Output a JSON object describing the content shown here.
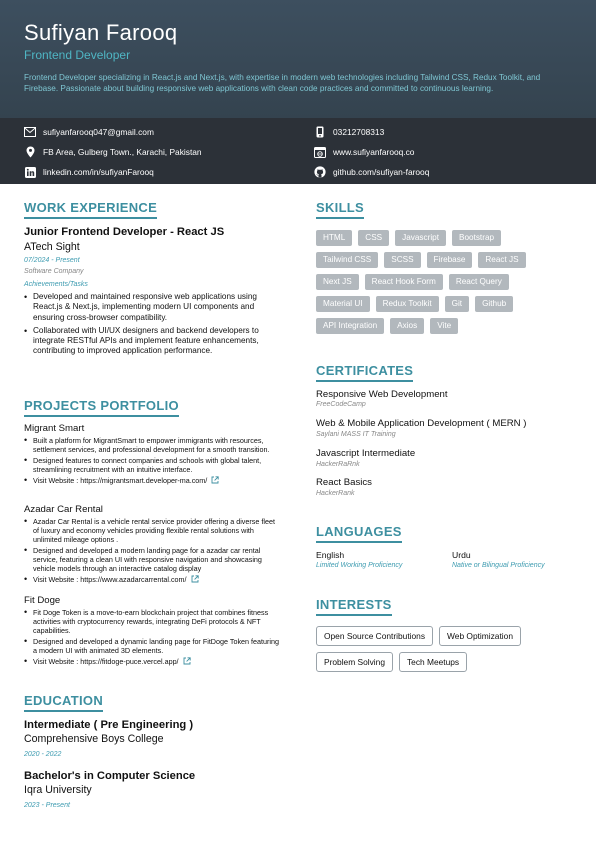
{
  "header": {
    "name": "Sufiyan Farooq",
    "role": "Frontend Developer",
    "summary": "Frontend Developer specializing in React.js and Next.js, with expertise in modern web technologies including Tailwind CSS, Redux Toolkit, and Firebase. Passionate about building responsive web applications with clean code practices and committed to continuous learning."
  },
  "contact": {
    "email": "sufiyanfarooq047@gmail.com",
    "phone": "03212708313",
    "address": "FB Area, Gulberg Town., Karachi, Pakistan",
    "website": "www.sufiyanfarooq.co",
    "linkedin": "linkedin.com/in/sufiyanFarooq",
    "github": "github.com/sufiyan-farooq",
    "icons": [
      "mail-icon",
      "phone-icon",
      "location-icon",
      "globe-icon",
      "linkedin-icon",
      "github-icon"
    ]
  },
  "work": {
    "title": "WORK EXPERIENCE",
    "job_title": "Junior Frontend Developer - React JS",
    "company": "ATech Sight",
    "dates": "07/2024 - Present",
    "company_type": "Software Company",
    "achievements_label": "Achievements/Tasks",
    "bullets": [
      "Developed and maintained responsive web applications using React.js & Next.js, implementing modern UI components and ensuring cross-browser compatibility.",
      "Collaborated with UI/UX designers and backend developers to integrate RESTful APIs and implement feature enhancements, contributing to improved application performance."
    ]
  },
  "projects": {
    "title": "PROJECTS PORTFOLIO",
    "items": [
      {
        "name": "Migrant Smart",
        "bullets": [
          "Built a platform for MigrantSmart to empower immigrants with resources, settlement services, and professional development for a smooth transition.",
          "Designed features to connect companies and schools with global talent, streamlining recruitment with an intuitive interface."
        ],
        "link": "Visit Website : https://migrantsmart.developer-ma.com/"
      },
      {
        "name": "Azadar Car Rental",
        "bullets": [
          "Azadar Car Rental is a vehicle rental service provider offering a diverse fleet of luxury and economy vehicles providing flexible rental solutions with unlimited mileage options .",
          "Designed and developed a modern landing page for a azadar car rental service, featuring a clean UI with responsive navigation and showcasing vehicle models through an interactive catalog display"
        ],
        "link": "Visit Website : https://www.azadarcarrental.com/"
      },
      {
        "name": "Fit Doge",
        "bullets": [
          "Fit Doge Token is a move-to-earn blockchain project that combines fitness activities with cryptocurrency rewards, integrating DeFi protocols & NFT capabilities.",
          "Designed and developed a dynamic landing page for FitDoge Token featuring a modern UI with animated 3D elements."
        ],
        "link": "Visit Website : https://fitdoge-puce.vercel.app/"
      }
    ]
  },
  "education": {
    "title": "EDUCATION",
    "items": [
      {
        "degree": "Intermediate ( Pre Engineering )",
        "school": "Comprehensive Boys College",
        "dates": "2020 - 2022"
      },
      {
        "degree": "Bachelor's in Computer Science",
        "school": "Iqra University",
        "dates": "2023 - Present"
      }
    ]
  },
  "skills": {
    "title": "SKILLS",
    "items": [
      "HTML",
      "CSS",
      "Javascript",
      "Bootstrap",
      "Tailwind CSS",
      "SCSS",
      "Firebase",
      "React JS",
      "Next JS",
      "React Hook Form",
      "React Query",
      "Material UI",
      "Redux Toolkit",
      "Git",
      "Github",
      "API Integration",
      "Axios",
      "Vite"
    ]
  },
  "certificates": {
    "title": "CERTIFICATES",
    "items": [
      {
        "name": "Responsive Web Development",
        "issuer": "FreeCodeCamp"
      },
      {
        "name": "Web & Mobile Application Development ( MERN )",
        "issuer": "Saylani MASS IT Training"
      },
      {
        "name": "Javascript Intermediate",
        "issuer": "HackerRaRnk"
      },
      {
        "name": "React Basics",
        "issuer": "HackerRank"
      }
    ]
  },
  "languages": {
    "title": "LANGUAGES",
    "items": [
      {
        "name": "English",
        "level": "Limited Working Proficiency"
      },
      {
        "name": "Urdu",
        "level": "Native or Bilingual Proficiency"
      }
    ]
  },
  "interests": {
    "title": "INTERESTS",
    "items": [
      "Open Source Contributions",
      "Web Optimization",
      "Problem Solving",
      "Tech Meetups"
    ]
  },
  "colors": {
    "header_bg": "#3d4f5f",
    "contact_bg": "#2c3138",
    "accent": "#3d8fa0",
    "skill_tag": "#b2b8bd"
  }
}
